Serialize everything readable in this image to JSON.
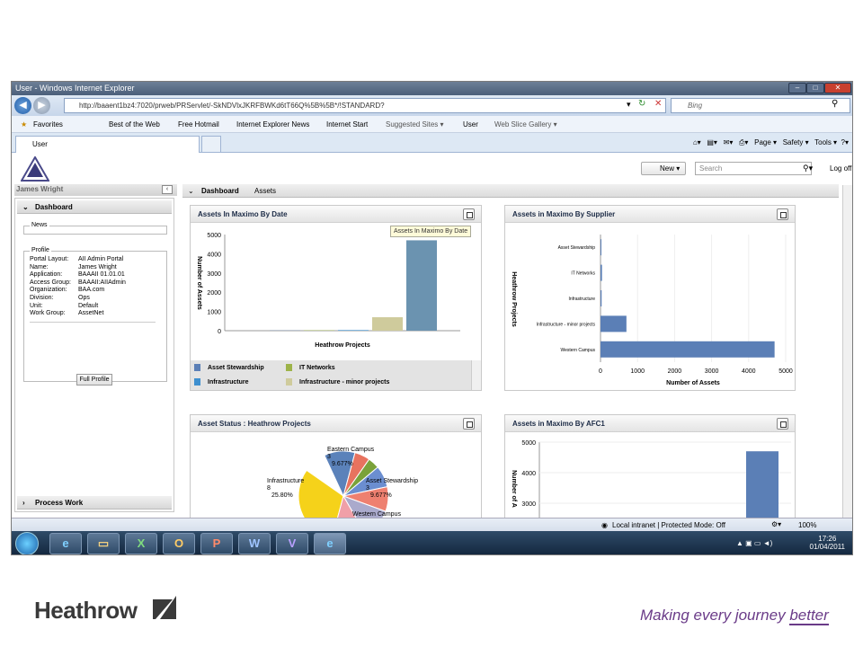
{
  "window": {
    "title": "User - Windows Internet Explorer",
    "url": "http://baaent1bz4:7020/prweb/PRServlet/-SkNDVlxJKRFBWKd6tT66Q%5B%5B*/!STANDARD?",
    "search_placeholder": "Bing"
  },
  "favorites": {
    "label": "Favorites",
    "items": [
      "Best of the Web",
      "Free Hotmail",
      "Internet Explorer News",
      "Internet Start",
      "Suggested Sites ▾",
      "User",
      "Web Slice Gallery ▾"
    ]
  },
  "tab": {
    "label": "User"
  },
  "commands": {
    "page": "Page ▾",
    "safety": "Safety ▾",
    "tools": "Tools ▾",
    "help": "?▾"
  },
  "app": {
    "new_label": "New",
    "search_placeholder": "Search",
    "logoff": "Log off",
    "user_name": "James Wright",
    "dashboard_tab": "Dashboard",
    "assets_tab": "Assets"
  },
  "left": {
    "section": "Dashboard",
    "news": "News",
    "profile_legend": "Profile",
    "profile": [
      [
        "Portal Layout:",
        "AII Admin Portal"
      ],
      [
        "Name:",
        "James Wright"
      ],
      [
        "Application:",
        "BAAAII 01.01.01"
      ],
      [
        "Access Group:",
        "BAAAII:AIIAdmin"
      ],
      [
        "Organization:",
        "BAA.com"
      ],
      [
        "Division:",
        "Ops"
      ],
      [
        "Unit:",
        "Default"
      ],
      [
        "Work Group:",
        "AssetNet"
      ]
    ],
    "full_profile": "Full Profile",
    "process_work": "Process Work"
  },
  "gadgets": {
    "g1": {
      "title": "Assets In Maximo By Date",
      "tooltip": "Assets In Maximo By Date",
      "ylabel": "Number of Assets",
      "xlabel": "Heathrow Projects",
      "legend": [
        "Asset Stewardship",
        "IT Networks",
        "Infrastructure",
        "Infrastructure - minor projects"
      ]
    },
    "g2": {
      "title": "Assets in Maximo By Supplier",
      "ylabel": "Heathrow Projects",
      "xlabel": "Number of Assets"
    },
    "g3": {
      "title": "Asset Status : Heathrow Projects",
      "labels": [
        {
          "name": "Eastern Campus",
          "count": "3",
          "pct": "9.677%"
        },
        {
          "name": "Infrastructure",
          "count": "8",
          "pct": "25.80%"
        },
        {
          "name": "Asset Stewardship",
          "count": "3",
          "pct": "9.677%"
        },
        {
          "name": "Western Campus",
          "count": "",
          "pct": ""
        }
      ]
    },
    "g4": {
      "title": "Assets in Maximo By AFC1",
      "ylabel": "Number of A"
    }
  },
  "status": {
    "zone": "Local intranet | Protected Mode: Off",
    "zoom": "100%"
  },
  "clock": {
    "time": "17:26",
    "date": "01/04/2011"
  },
  "footer": {
    "brand": "Heathrow",
    "tagline_a": "Making every journey ",
    "tagline_b": "better"
  },
  "chart_data": [
    {
      "type": "bar",
      "title": "Assets In Maximo By Date",
      "xlabel": "Heathrow Projects",
      "ylabel": "Number of Assets",
      "ylim": [
        0,
        5000
      ],
      "yticks": [
        0,
        1000,
        2000,
        3000,
        4000,
        5000
      ],
      "categories": [
        "Asset Stewardship",
        "IT Networks",
        "Infrastructure",
        "Infrastructure - minor projects",
        "Western Campus"
      ],
      "values": [
        10,
        20,
        30,
        700,
        4700
      ],
      "colors": [
        "#5b7fb6",
        "#9db349",
        "#3d8fcf",
        "#cfcb9c",
        "#6b93b0"
      ]
    },
    {
      "type": "bar",
      "orientation": "horizontal",
      "title": "Assets in Maximo By Supplier",
      "xlabel": "Number of Assets",
      "ylabel": "Heathrow Projects",
      "xlim": [
        0,
        5000
      ],
      "xticks": [
        0,
        1000,
        2000,
        3000,
        4000,
        5000
      ],
      "categories": [
        "Asset Stewardship",
        "IT Networks",
        "Infrastructure",
        "Infrastructure - minor projects",
        "Western Campus"
      ],
      "values": [
        15,
        40,
        30,
        700,
        4700
      ]
    },
    {
      "type": "pie",
      "title": "Asset Status : Heathrow Projects",
      "slices": [
        {
          "label": "Infrastructure",
          "value": 25.8
        },
        {
          "label": "Eastern Campus",
          "value": 9.677
        },
        {
          "label": "Asset Stewardship",
          "value": 9.677
        },
        {
          "label": "Western Campus",
          "value": 9.677
        }
      ]
    },
    {
      "type": "bar",
      "title": "Assets in Maximo By AFC1",
      "ylabel": "Number of A",
      "ylim": [
        2000,
        5000
      ],
      "yticks": [
        2000,
        3000,
        4000,
        5000
      ],
      "values": [
        4700
      ]
    }
  ]
}
